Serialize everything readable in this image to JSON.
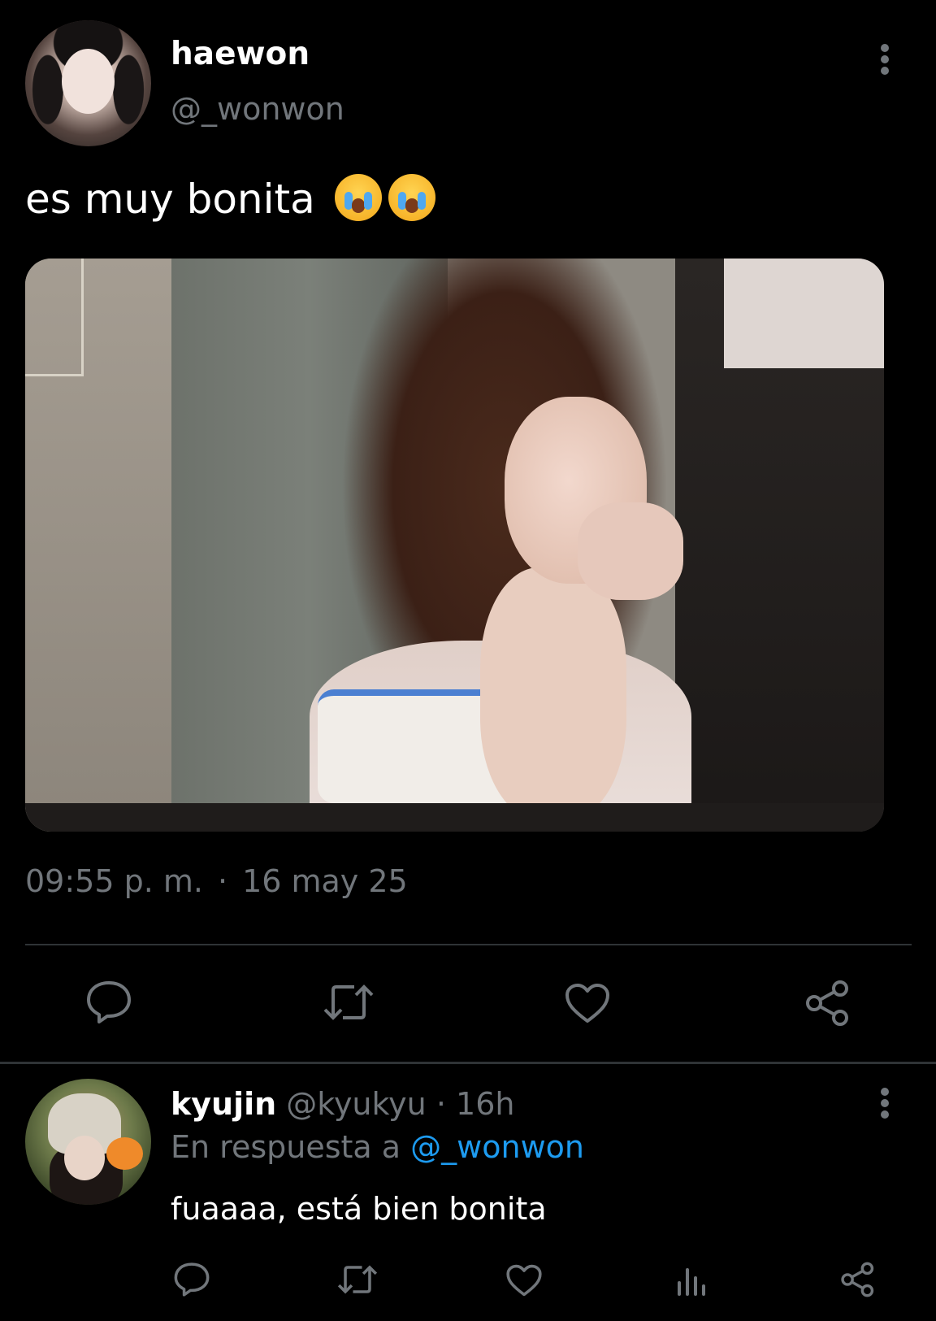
{
  "tweet": {
    "author_name": "haewon",
    "author_handle": "@_wonwon",
    "text": "es muy bonita",
    "emojis": [
      "loudly-crying-face",
      "loudly-crying-face"
    ],
    "time": "09:55 p. m.",
    "separator": "·",
    "date": "16 may 25",
    "actions": [
      "reply-icon",
      "retweet-icon",
      "like-icon",
      "share-icon"
    ]
  },
  "reply": {
    "author_name": "kyujin",
    "author_handle": "@kyukyu",
    "meta_sep": "·",
    "age": "16h",
    "in_reply_to_prefix": "En respuesta a",
    "in_reply_to_handle": "@_wonwon",
    "text": "fuaaaa, está bien bonita",
    "actions": [
      "reply-icon",
      "retweet-icon",
      "like-icon",
      "views-icon",
      "share-icon"
    ]
  },
  "colors": {
    "background": "#000000",
    "primary_text": "#ffffff",
    "secondary_text": "#71767b",
    "link": "#1d9bf0",
    "divider": "#2f3336"
  }
}
